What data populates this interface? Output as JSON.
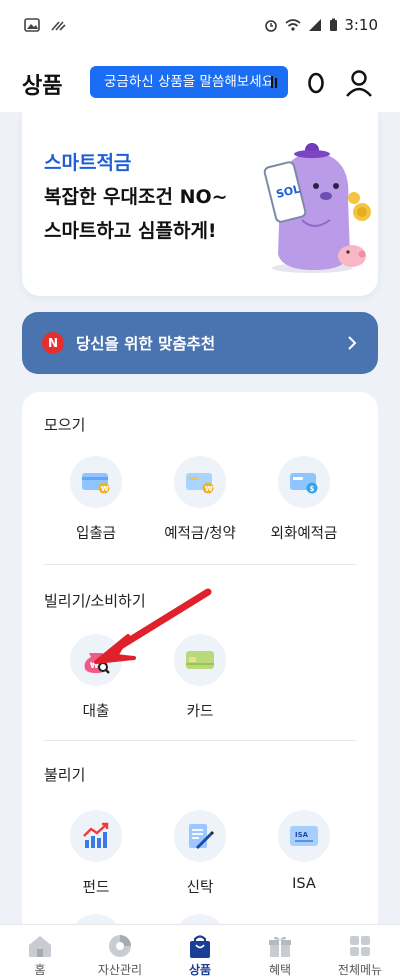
{
  "status_bar": {
    "time": "3:10"
  },
  "header": {
    "title": "상품",
    "search_tooltip": "궁금하신 상품을 말씀해보세요"
  },
  "banner": {
    "kicker": "스마트적금",
    "line1": "복잡한 우대조건 NO~",
    "line2": "스마트하고 심플하게!",
    "brand_mark": "SOL"
  },
  "recommend": {
    "badge": "N",
    "label": "당신을 위한 맞춤추천"
  },
  "sections": [
    {
      "title": "모으기",
      "items": [
        {
          "label": "입출금",
          "icon": "wallet-won-icon"
        },
        {
          "label": "예적금/청약",
          "icon": "card-won-icon"
        },
        {
          "label": "외화예적금",
          "icon": "card-dollar-icon"
        }
      ]
    },
    {
      "title": "빌리기/소비하기",
      "items": [
        {
          "label": "대출",
          "icon": "loan-bag-icon"
        },
        {
          "label": "카드",
          "icon": "credit-card-icon"
        }
      ]
    },
    {
      "title": "불리기",
      "items": [
        {
          "label": "펀드",
          "icon": "fund-chart-icon"
        },
        {
          "label": "신탁",
          "icon": "trust-document-icon"
        },
        {
          "label": "ISA",
          "icon": "isa-card-icon",
          "card_text": "ISA"
        }
      ]
    }
  ],
  "bottom_nav": [
    {
      "label": "홈",
      "icon": "home-icon",
      "active": false
    },
    {
      "label": "자산관리",
      "icon": "asset-chart-icon",
      "active": false
    },
    {
      "label": "상품",
      "icon": "shopping-bag-icon",
      "active": true
    },
    {
      "label": "혜택",
      "icon": "gift-icon",
      "active": false
    },
    {
      "label": "전체메뉴",
      "icon": "grid-menu-icon",
      "active": false
    }
  ],
  "colors": {
    "accent": "#1b6ef3",
    "recommend_bg": "#4a74b0",
    "nav_active": "#1b3e96",
    "arrow": "#e0202a"
  }
}
